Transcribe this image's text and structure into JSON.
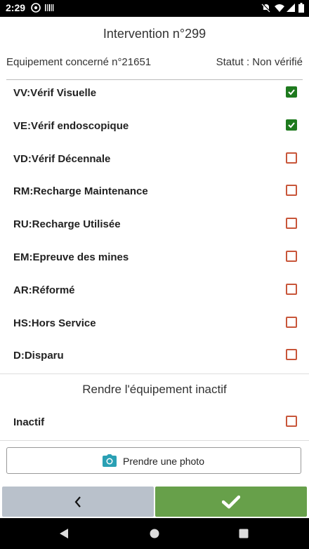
{
  "status_bar": {
    "time": "2:29"
  },
  "header": {
    "title": "Intervention n°299",
    "equipment": "Equipement concerné n°21651",
    "status": "Statut : Non vérifié"
  },
  "checks": [
    {
      "label": "VV:Vérif Visuelle",
      "checked": true
    },
    {
      "label": "VE:Vérif endoscopique",
      "checked": true
    },
    {
      "label": "VD:Vérif Décennale",
      "checked": false
    },
    {
      "label": "RM:Recharge Maintenance",
      "checked": false
    },
    {
      "label": "RU:Recharge Utilisée",
      "checked": false
    },
    {
      "label": "EM:Epreuve des mines",
      "checked": false
    },
    {
      "label": "AR:Réformé",
      "checked": false
    },
    {
      "label": "HS:Hors Service",
      "checked": false
    },
    {
      "label": "D:Disparu",
      "checked": false
    }
  ],
  "inactive_section": {
    "title": "Rendre l'équipement inactif",
    "label": "Inactif",
    "checked": false
  },
  "photo_button": {
    "label": "Prendre une photo",
    "icon": "camera-icon"
  },
  "back_button": {
    "icon": "chevron-left-icon"
  },
  "confirm_button": {
    "icon": "check-icon"
  },
  "colors": {
    "checked": "#1e7a1e",
    "unchecked_border": "#c8563a",
    "confirm": "#67a04a",
    "back": "#b9c1cb",
    "camera": "#2aa0b4"
  }
}
